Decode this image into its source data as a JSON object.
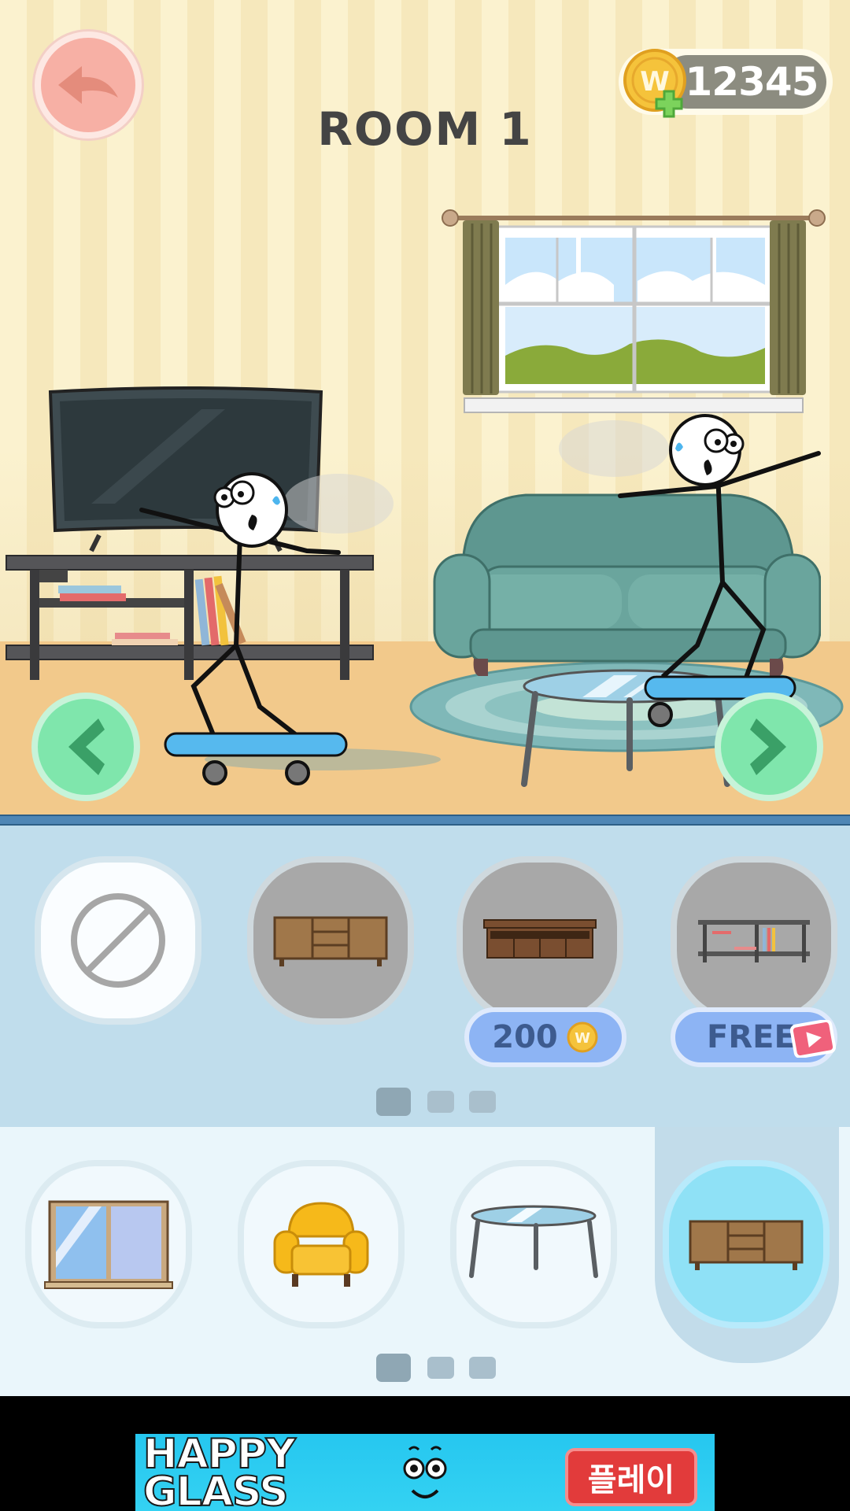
{
  "header": {
    "room_title": "ROOM 1",
    "coin_balance": "12345",
    "coin_symbol": "W"
  },
  "icons": {
    "back": "back-arrow-icon",
    "prev": "chevron-left-icon",
    "next": "chevron-right-icon",
    "coin": "coin-icon",
    "plus": "plus-icon",
    "none": "none-icon",
    "video": "video-play-icon"
  },
  "colors": {
    "back_button": "#f7b0a5",
    "nav_button": "#7fe6ac",
    "price_tag": "#8db4f4",
    "selected_slot": "#8fe1f6",
    "wall": "#fbf2cf",
    "floor": "#f2c98b"
  },
  "variant_row": {
    "items": [
      {
        "name": "none",
        "price": null
      },
      {
        "name": "wooden-cabinet",
        "price": null
      },
      {
        "name": "tv-stand",
        "price": "200"
      },
      {
        "name": "shelf-with-books",
        "price": "FREE"
      }
    ],
    "page": 1,
    "pages": 3
  },
  "category_row": {
    "items": [
      "window",
      "armchair",
      "coffee-table",
      "cabinet"
    ],
    "selected": "cabinet",
    "page": 1,
    "pages": 3
  },
  "ad": {
    "title_line1": "HAPPY",
    "title_line2": "GLASS",
    "play_label": "플레이"
  }
}
